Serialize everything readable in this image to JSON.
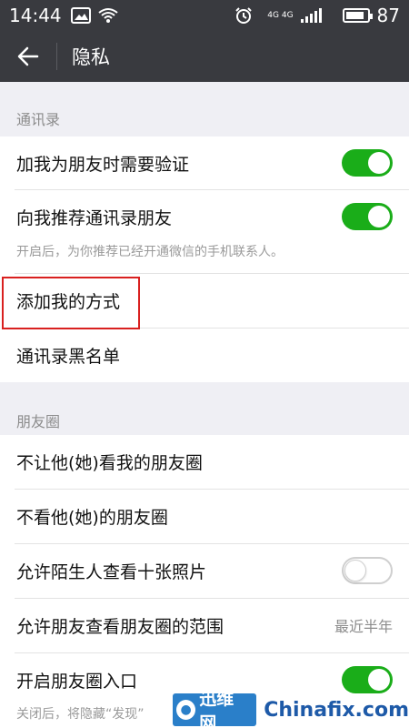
{
  "status_bar": {
    "time": "14:44",
    "network": "4G 4G",
    "battery": "87",
    "battery_level": 0.87,
    "icons": [
      "image-icon",
      "wifi-icon",
      "alarm-icon",
      "signal-icon",
      "battery-icon"
    ]
  },
  "header": {
    "back_icon": "back-arrow-icon",
    "title": "隐私"
  },
  "sections": {
    "contacts": {
      "title": "通讯录",
      "items": [
        {
          "label": "加我为朋友时需要验证",
          "toggle": true
        },
        {
          "label": "向我推荐通讯录朋友",
          "toggle": true,
          "hint": "开启后，为你推荐已经开通微信的手机联系人。"
        },
        {
          "label": "添加我的方式"
        },
        {
          "label": "通讯录黑名单"
        }
      ]
    },
    "moments": {
      "title": "朋友圈",
      "items": [
        {
          "label": "不让他(她)看我的朋友圈"
        },
        {
          "label": "不看他(她)的朋友圈"
        },
        {
          "label": "允许陌生人查看十张照片",
          "toggle": false
        },
        {
          "label": "允许朋友查看朋友圈的范围",
          "value": "最近半年"
        },
        {
          "label": "开启朋友圈入口",
          "toggle": true,
          "hint": "关闭后，将隐藏“发现”"
        }
      ]
    }
  },
  "watermark": {
    "brand": "迅维网",
    "site": "Chinafix.com"
  },
  "colors": {
    "header_bg": "#393a3f",
    "toggle_on": "#1aad19",
    "highlight": "#d9201f"
  }
}
